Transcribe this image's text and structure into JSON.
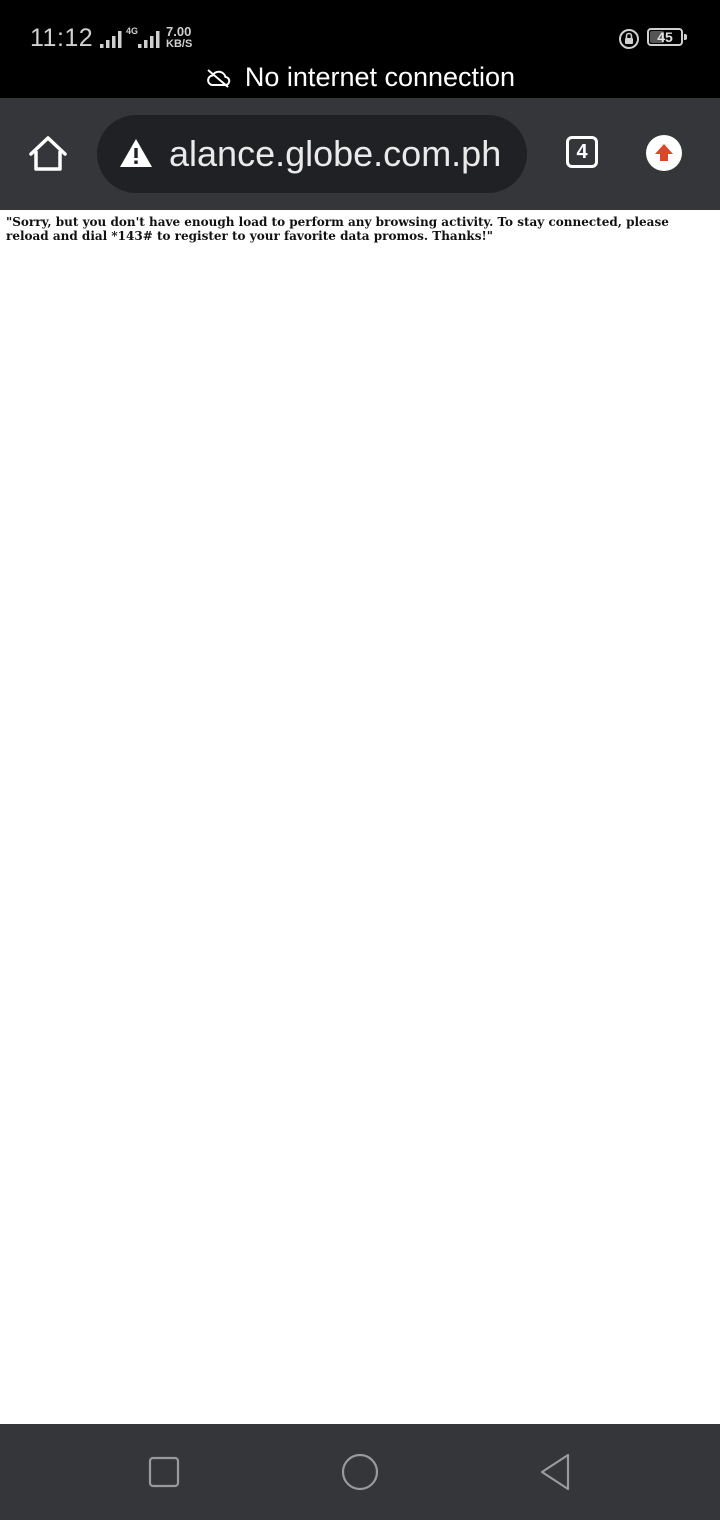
{
  "status_bar": {
    "time": "11:12",
    "network_tag": "4G",
    "speed_value": "7.00",
    "speed_unit": "KB/S",
    "battery_level": "45",
    "icons": [
      "signal-icon",
      "signal-icon",
      "rotation-lock-icon",
      "battery-icon"
    ]
  },
  "offline_banner": {
    "text": "No internet connection",
    "icon": "cloud-off-icon"
  },
  "toolbar": {
    "url": "alance.globe.com.ph",
    "security_icon": "warning-icon",
    "tab_count": "4",
    "home_icon": "home-icon",
    "update_icon": "update-arrow-icon"
  },
  "page": {
    "message": "\"Sorry, but you don't have enough load to perform any browsing activity. To stay connected, please reload and dial *143# to register to your favorite data promos. Thanks!\""
  },
  "navigation": {
    "items": [
      "recent-apps",
      "home",
      "back"
    ]
  },
  "colors": {
    "status_bar_bg": "#000000",
    "toolbar_bg": "#35363a",
    "url_bar_bg": "#202124",
    "update_accent": "#d9482b",
    "nav_bar_bg": "#35363a"
  }
}
